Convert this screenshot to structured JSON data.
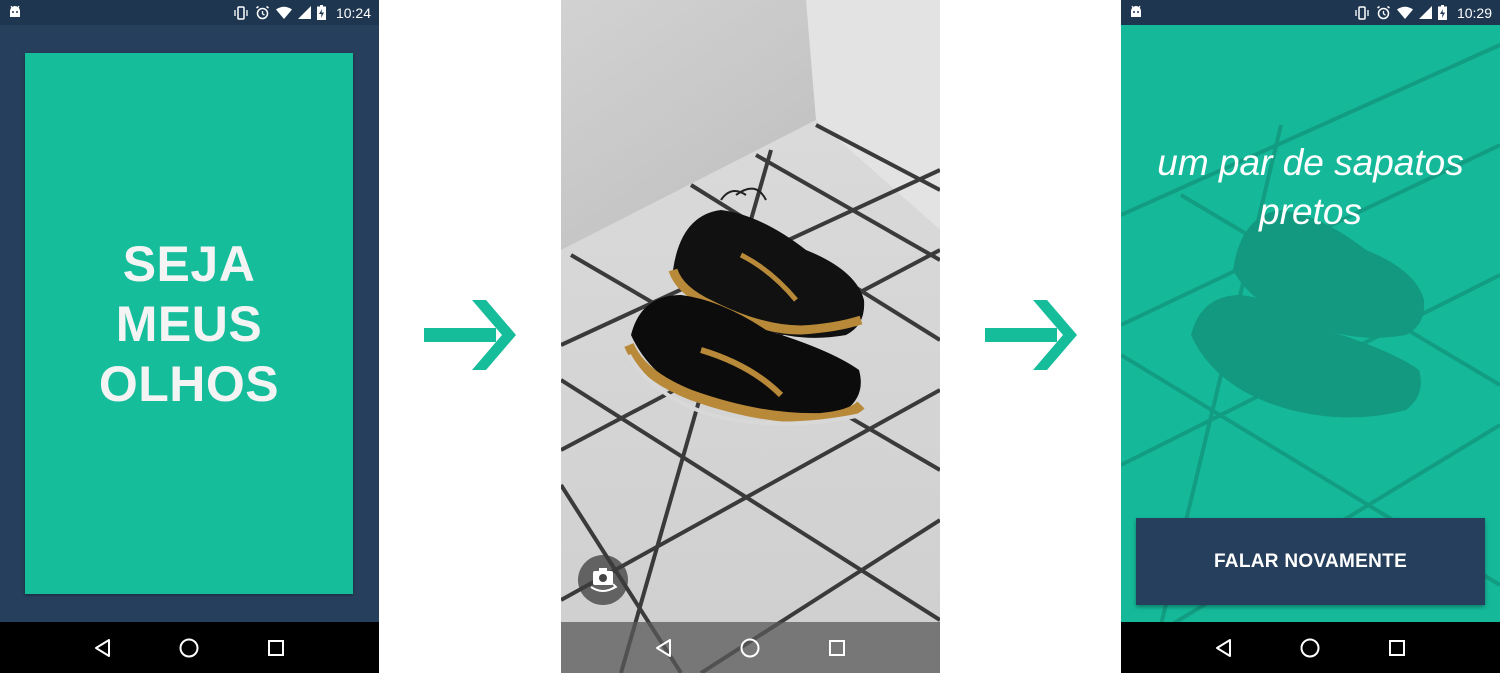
{
  "screen1": {
    "status_time": "10:24",
    "hero_label": "SEJA MEUS OLHOS"
  },
  "screen2": {
    "switch_camera_icon": "switch-camera-icon"
  },
  "screen3": {
    "status_time": "10:29",
    "description": "um par de sapatos pretos",
    "speak_again_label": "FALAR NOVAMENTE"
  },
  "icons": {
    "nav": [
      "back-icon",
      "home-icon",
      "recents-icon"
    ],
    "status": [
      "android-icon",
      "vibrate-icon",
      "alarm-icon",
      "wifi-icon",
      "cell-signal-icon",
      "battery-charging-icon"
    ],
    "flow": "arrow-right-icon"
  },
  "colors": {
    "accent_green": "#15bd9b",
    "navy": "#263f5c",
    "nav_black": "#000000"
  }
}
